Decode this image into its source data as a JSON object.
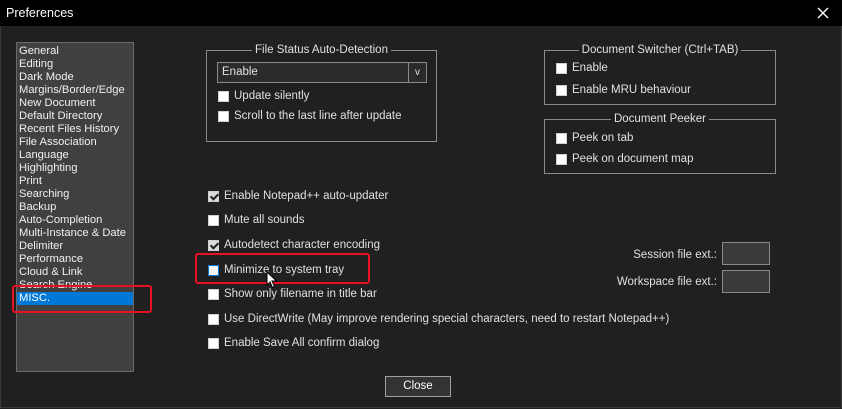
{
  "window": {
    "title": "Preferences"
  },
  "categories": [
    "General",
    "Editing",
    "Dark Mode",
    "Margins/Border/Edge",
    "New Document",
    "Default Directory",
    "Recent Files History",
    "File Association",
    "Language",
    "Highlighting",
    "Print",
    "Searching",
    "Backup",
    "Auto-Completion",
    "Multi-Instance & Date",
    "Delimiter",
    "Performance",
    "Cloud & Link",
    "Search Engine",
    "MISC."
  ],
  "selected_category": "MISC.",
  "file_status": {
    "title": "File Status Auto-Detection",
    "select_value": "Enable",
    "dropdown_glyph": "v",
    "options": [
      {
        "label": "Update silently",
        "checked": false
      },
      {
        "label": "Scroll to the last line after update",
        "checked": false
      }
    ]
  },
  "doc_switcher": {
    "title": "Document Switcher (Ctrl+TAB)",
    "options": [
      {
        "label": "Enable",
        "checked": false
      },
      {
        "label": "Enable MRU behaviour",
        "checked": false
      }
    ]
  },
  "doc_peeker": {
    "title": "Document Peeker",
    "options": [
      {
        "label": "Peek on tab",
        "checked": false
      },
      {
        "label": "Peek on document map",
        "checked": false
      }
    ]
  },
  "misc_options": [
    {
      "label": "Enable Notepad++ auto-updater",
      "checked": true
    },
    {
      "label": "Mute all sounds",
      "checked": false
    },
    {
      "label": "Autodetect character encoding",
      "checked": true
    },
    {
      "label": "Minimize to system tray",
      "checked": false
    },
    {
      "label": "Show only filename in title bar",
      "checked": false
    },
    {
      "label": "Use DirectWrite (May improve rendering special characters, need to restart Notepad++)",
      "checked": false
    },
    {
      "label": "Enable Save All confirm dialog",
      "checked": false
    }
  ],
  "session_ext": {
    "label": "Session file ext.:",
    "value": ""
  },
  "workspace_ext": {
    "label": "Workspace file ext.:",
    "value": ""
  },
  "buttons": {
    "close_label": "Close"
  },
  "colors": {
    "accent": "#0078d7",
    "highlight_red": "#e81123",
    "background": "#202020"
  }
}
